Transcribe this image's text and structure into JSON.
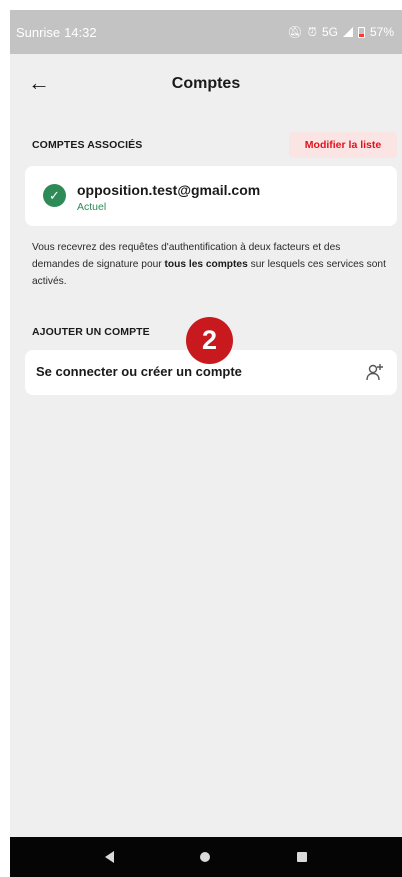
{
  "status_bar": {
    "carrier": "Sunrise",
    "time": "14:32",
    "network": "5G",
    "battery": "57%",
    "icons": [
      "mute-icon",
      "alarm-icon",
      "signal-icon",
      "battery-icon"
    ]
  },
  "header": {
    "title": "Comptes",
    "back_icon": "arrow-left-icon"
  },
  "linked_accounts": {
    "section_label": "COMPTES ASSOCIÉS",
    "edit_label": "Modifier la liste",
    "accounts": [
      {
        "email": "opposition.test@gmail.com",
        "status": "Actuel",
        "icon": "check-circle-icon"
      }
    ],
    "info_before": "Vous recevrez des requêtes d'authentification à deux facteurs et des demandes de signature pour ",
    "info_bold": "tous les comptes",
    "info_after": " sur lesquels ces services sont activés."
  },
  "add_account": {
    "section_label": "AJOUTER UN COMPTE",
    "badge": "2",
    "connect_label": "Se connecter ou créer un compte",
    "icon": "add-user-icon"
  },
  "nav_bar": {
    "icons": [
      "nav-back-icon",
      "nav-home-icon",
      "nav-recent-icon"
    ]
  },
  "colors": {
    "accent_red": "#e2121d",
    "success_green": "#2e8b57",
    "badge_red": "#c8191e",
    "background": "#efefef"
  }
}
